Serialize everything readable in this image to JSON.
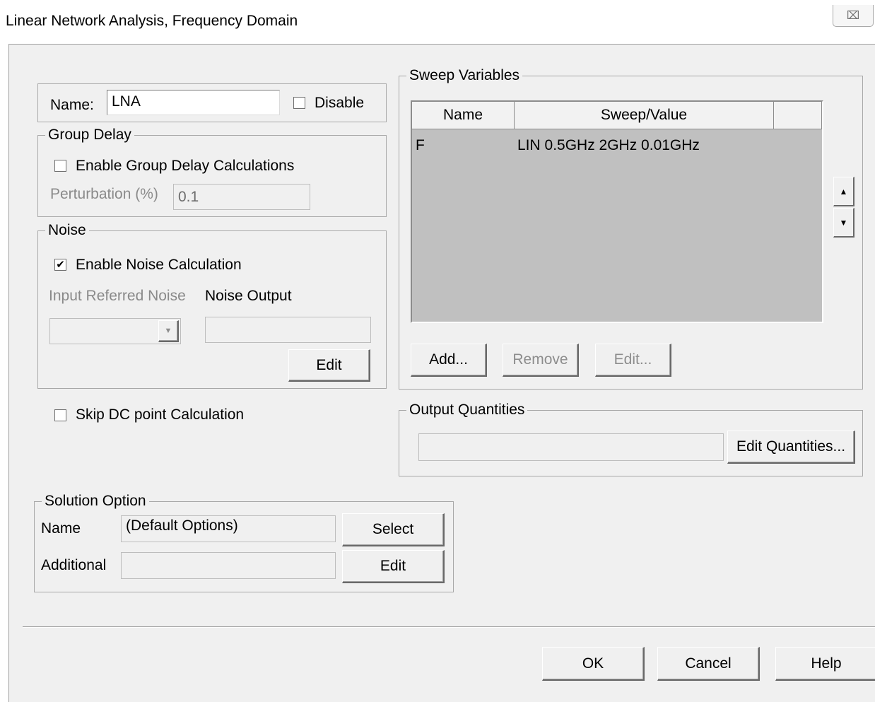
{
  "window": {
    "title": "Linear Network Analysis, Frequency Domain",
    "close_glyph": "⌧"
  },
  "name_row": {
    "label": "Name:",
    "value": "LNA",
    "disable_label": "Disable",
    "disable_checked": false
  },
  "group_delay": {
    "legend": "Group Delay",
    "enable_label": "Enable Group Delay Calculations",
    "enable_checked": false,
    "perturbation_label": "Perturbation (%)",
    "perturbation_value": "0.1"
  },
  "noise": {
    "legend": "Noise",
    "enable_label": "Enable Noise Calculation",
    "enable_checked": true,
    "check_glyph": "✔",
    "input_referred_label": "Input Referred Noise",
    "input_referred_value": "",
    "noise_output_label": "Noise Output",
    "noise_output_value": "",
    "edit_label": "Edit"
  },
  "skip_dc": {
    "label": "Skip DC point Calculation",
    "checked": false
  },
  "solution_option": {
    "legend": "Solution Option",
    "name_label": "Name",
    "name_value": "(Default Options)",
    "select_label": "Select",
    "additional_label": "Additional",
    "additional_value": "",
    "edit_label": "Edit"
  },
  "sweep_variables": {
    "legend": "Sweep Variables",
    "columns": [
      "Name",
      "Sweep/Value",
      ""
    ],
    "rows": [
      {
        "name": "F",
        "value": "LIN 0.5GHz 2GHz 0.01GHz"
      }
    ],
    "up_glyph": "▲",
    "down_glyph": "▼",
    "add_label": "Add...",
    "remove_label": "Remove",
    "edit_label": "Edit..."
  },
  "output_quantities": {
    "legend": "Output Quantities",
    "value": "",
    "edit_label": "Edit Quantities..."
  },
  "footer": {
    "ok_label": "OK",
    "cancel_label": "Cancel",
    "help_label": "Help"
  }
}
